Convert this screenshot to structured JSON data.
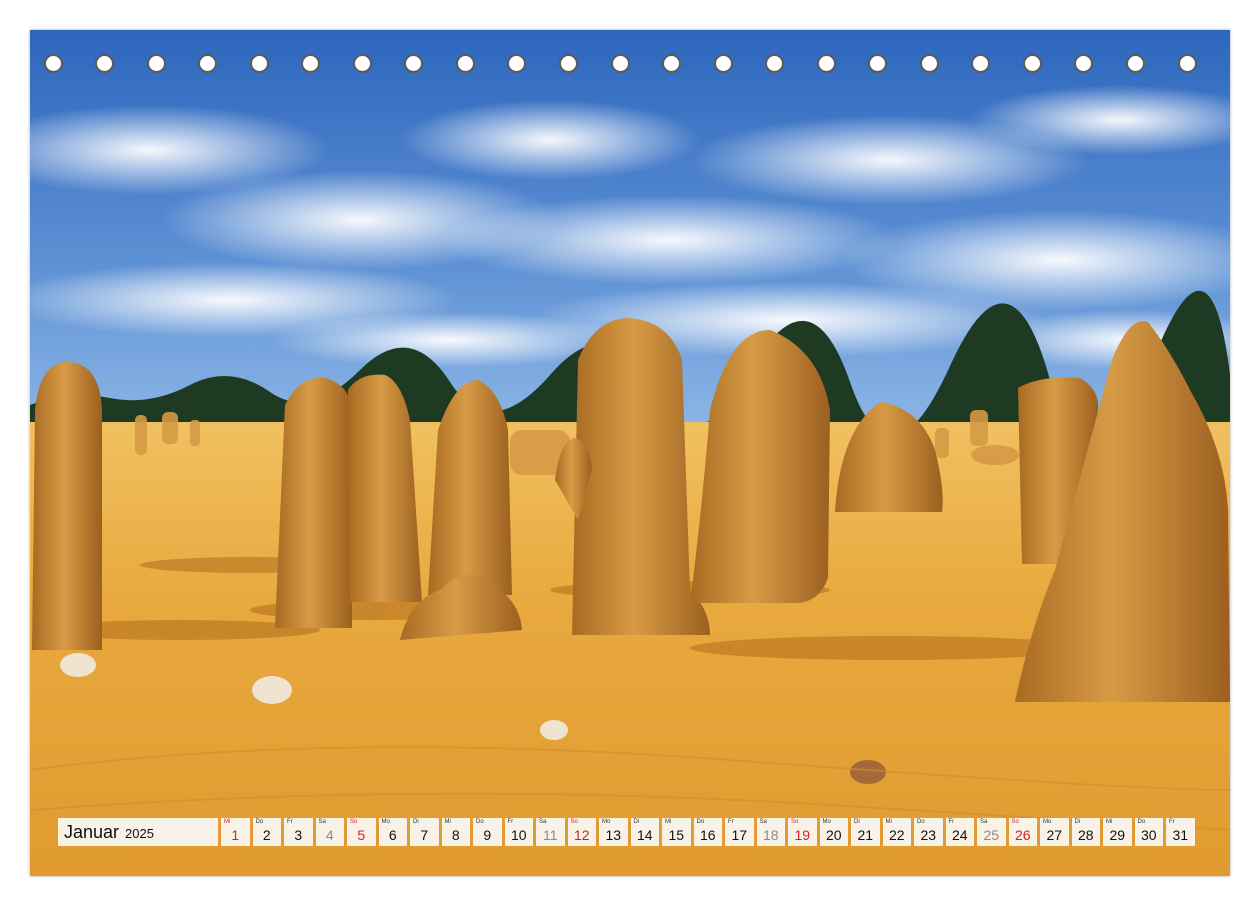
{
  "calendar": {
    "month": "Januar",
    "year": "2025",
    "days": [
      {
        "wd": "Mi",
        "n": "1",
        "t": "hol"
      },
      {
        "wd": "Do",
        "n": "2",
        "t": ""
      },
      {
        "wd": "Fr",
        "n": "3",
        "t": ""
      },
      {
        "wd": "Sa",
        "n": "4",
        "t": "sat"
      },
      {
        "wd": "So",
        "n": "5",
        "t": "sun"
      },
      {
        "wd": "Mo",
        "n": "6",
        "t": ""
      },
      {
        "wd": "Di",
        "n": "7",
        "t": ""
      },
      {
        "wd": "Mi",
        "n": "8",
        "t": ""
      },
      {
        "wd": "Do",
        "n": "9",
        "t": ""
      },
      {
        "wd": "Fr",
        "n": "10",
        "t": ""
      },
      {
        "wd": "Sa",
        "n": "11",
        "t": "sat"
      },
      {
        "wd": "So",
        "n": "12",
        "t": "sun"
      },
      {
        "wd": "Mo",
        "n": "13",
        "t": ""
      },
      {
        "wd": "Di",
        "n": "14",
        "t": ""
      },
      {
        "wd": "Mi",
        "n": "15",
        "t": ""
      },
      {
        "wd": "Do",
        "n": "16",
        "t": ""
      },
      {
        "wd": "Fr",
        "n": "17",
        "t": ""
      },
      {
        "wd": "Sa",
        "n": "18",
        "t": "sat"
      },
      {
        "wd": "So",
        "n": "19",
        "t": "sun"
      },
      {
        "wd": "Mo",
        "n": "20",
        "t": ""
      },
      {
        "wd": "Di",
        "n": "21",
        "t": ""
      },
      {
        "wd": "Mi",
        "n": "22",
        "t": ""
      },
      {
        "wd": "Do",
        "n": "23",
        "t": ""
      },
      {
        "wd": "Fr",
        "n": "24",
        "t": ""
      },
      {
        "wd": "Sa",
        "n": "25",
        "t": "sat"
      },
      {
        "wd": "So",
        "n": "26",
        "t": "sun"
      },
      {
        "wd": "Mo",
        "n": "27",
        "t": ""
      },
      {
        "wd": "Di",
        "n": "28",
        "t": ""
      },
      {
        "wd": "Mi",
        "n": "29",
        "t": ""
      },
      {
        "wd": "Do",
        "n": "30",
        "t": ""
      },
      {
        "wd": "Fr",
        "n": "31",
        "t": ""
      }
    ]
  },
  "binding": {
    "hole_count": 23
  },
  "colors": {
    "sky": "#2f6fc2",
    "sand": "#e3a43a",
    "rock": "#c98d33",
    "sunday_red": "#d3202a",
    "saturday_gray": "#8a8a8a"
  }
}
